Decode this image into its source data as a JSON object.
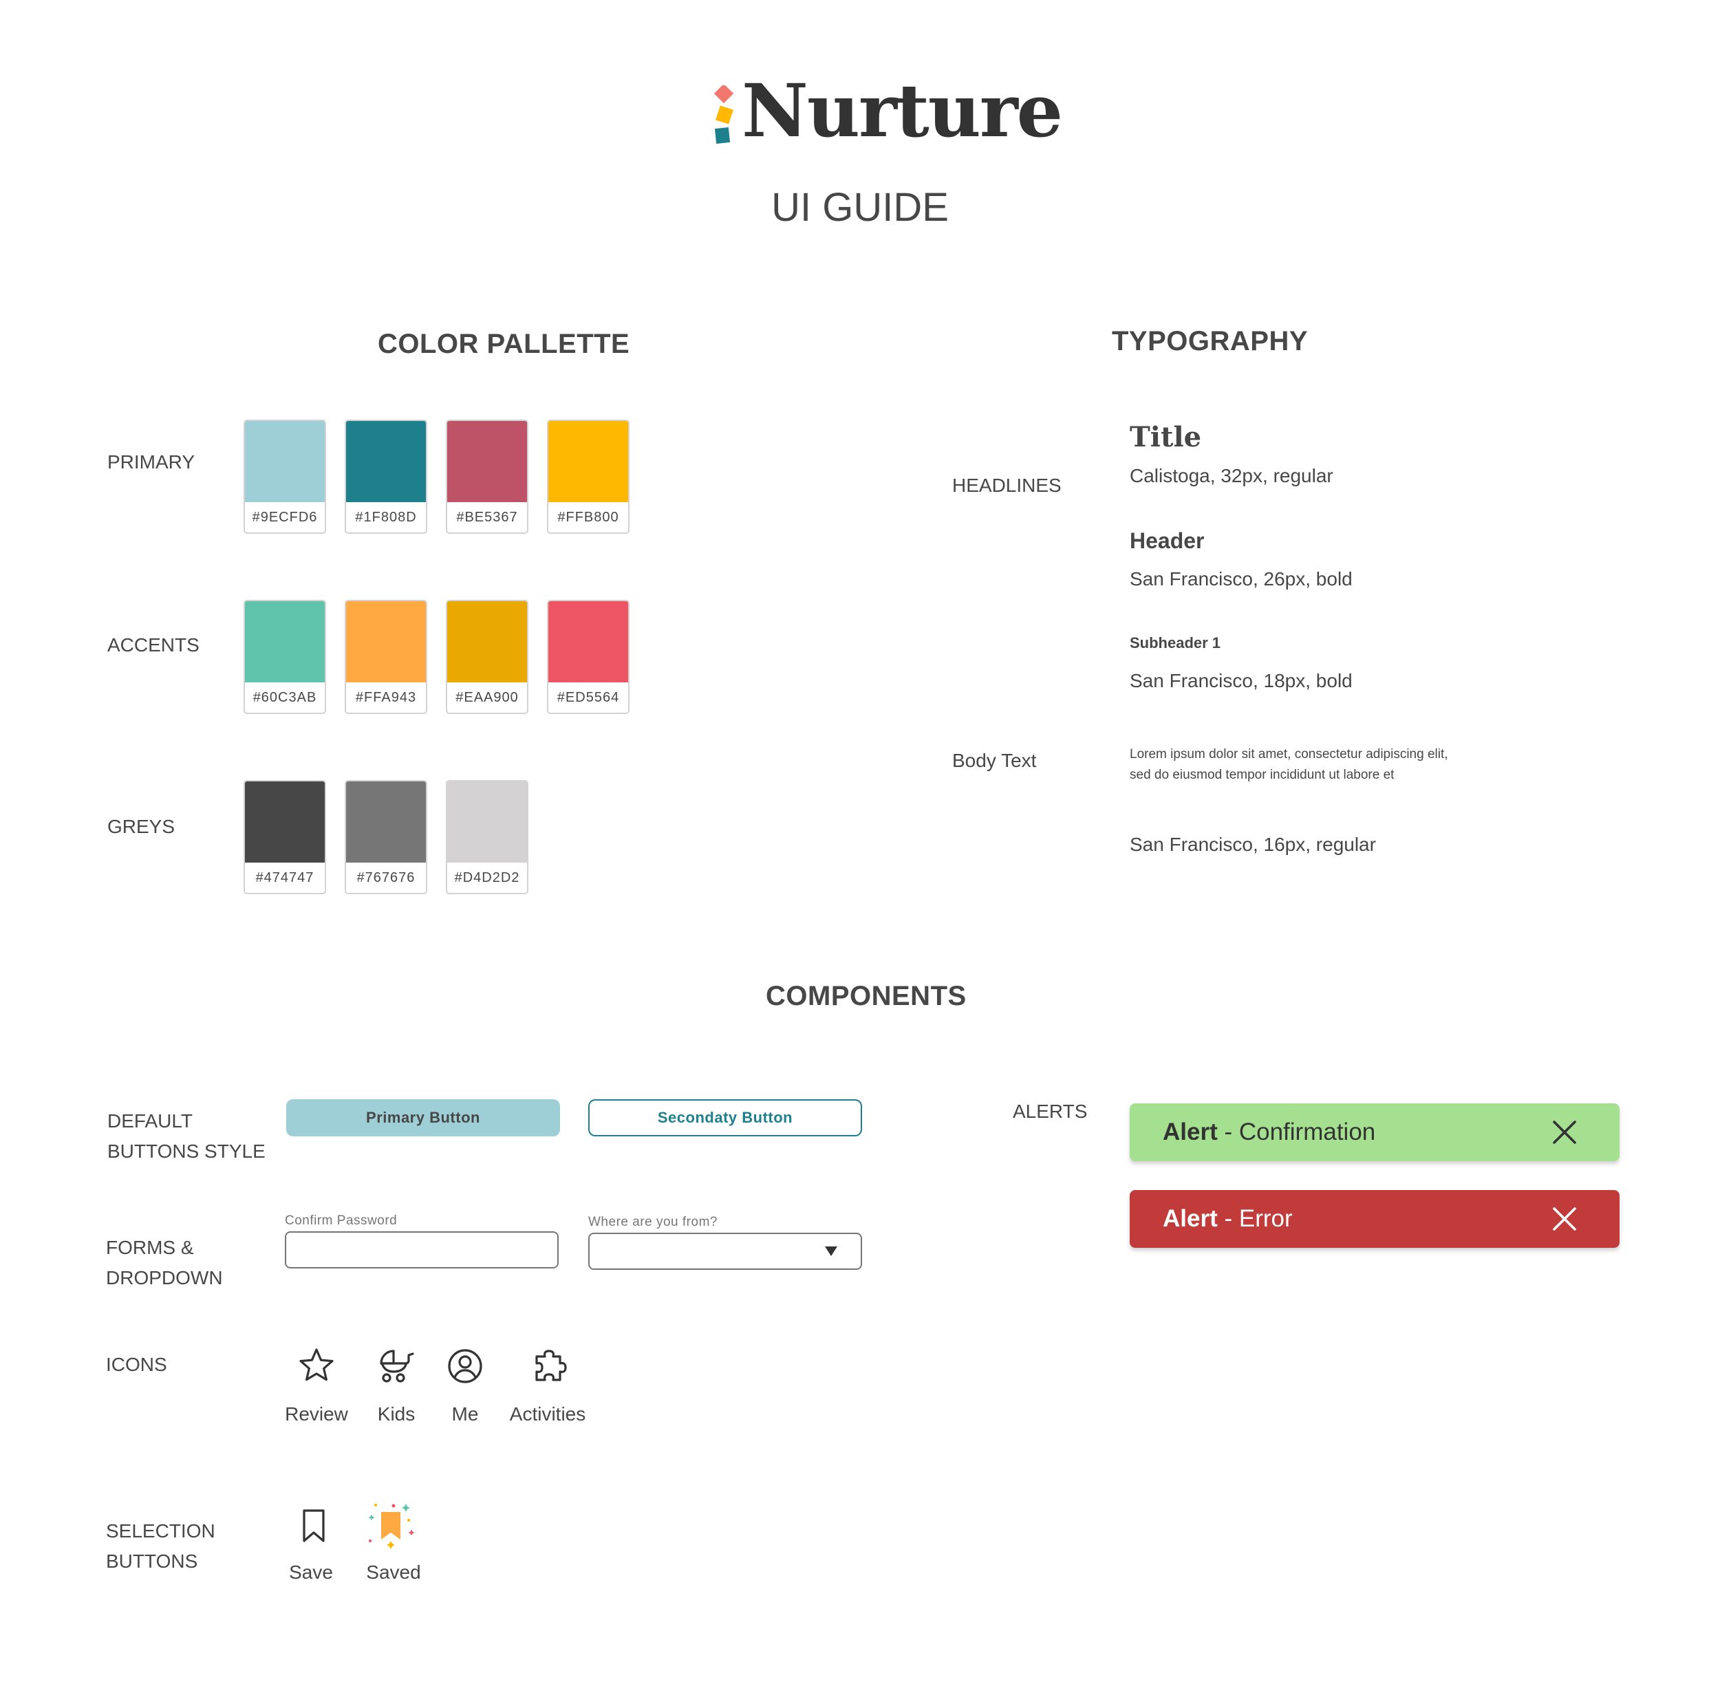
{
  "brand": {
    "name": "Nurture",
    "subtitle": "UI GUIDE"
  },
  "colors": {
    "title": "COLOR PALLETTE",
    "groups": [
      {
        "label": "PRIMARY",
        "swatches": [
          "#9ECFD6",
          "#1F808D",
          "#BE5367",
          "#FFB800"
        ]
      },
      {
        "label": "ACCENTS",
        "swatches": [
          "#60C3AB",
          "#FFA943",
          "#EAA900",
          "#ED5564"
        ]
      },
      {
        "label": "GREYS",
        "swatches": [
          "#474747",
          "#767676",
          "#D4D2D2"
        ]
      }
    ]
  },
  "typography": {
    "title": "TYPOGRAPHY",
    "headlines_label": "HEADLINES",
    "body_label": "Body Text",
    "title_sample": "Title",
    "title_desc": "Calistoga, 32px, regular",
    "header_sample": "Header",
    "header_desc": "San Francisco, 26px,  bold",
    "subheader_sample": "Subheader 1",
    "subheader_desc": "San Francisco, 18px,  bold",
    "body_sample": "Lorem ipsum dolor sit amet, consectetur adipiscing elit, sed do eiusmod tempor incididunt ut labore et",
    "body_desc": "San Francisco, 16px, regular"
  },
  "components": {
    "title": "COMPONENTS",
    "buttons_label_1": "DEFAULT",
    "buttons_label_2": "BUTTONS STYLE",
    "primary_button": "Primary Button",
    "secondary_button": "Secondaty Button",
    "forms_label_1": "FORMS &",
    "forms_label_2": "DROPDOWN",
    "field_password_label": "Confirm Password",
    "field_from_label": "Where are you from?",
    "icons_label": "ICONS",
    "icons": [
      {
        "name": "star-icon",
        "label": "Review"
      },
      {
        "name": "stroller-icon",
        "label": "Kids"
      },
      {
        "name": "user-circle-icon",
        "label": "Me"
      },
      {
        "name": "puzzle-icon",
        "label": "Activities"
      }
    ],
    "selection_label_1": "SELECTION",
    "selection_label_2": "BUTTONS",
    "save_label": "Save",
    "saved_label": "Saved",
    "alerts_label": "ALERTS",
    "alert_confirm_strong": "Alert",
    "alert_confirm_text": " - Confirmation",
    "alert_error_strong": "Alert",
    "alert_error_text": " - Error",
    "alert_confirm_color": "#A4E08F",
    "alert_error_color": "#C23B3B"
  }
}
